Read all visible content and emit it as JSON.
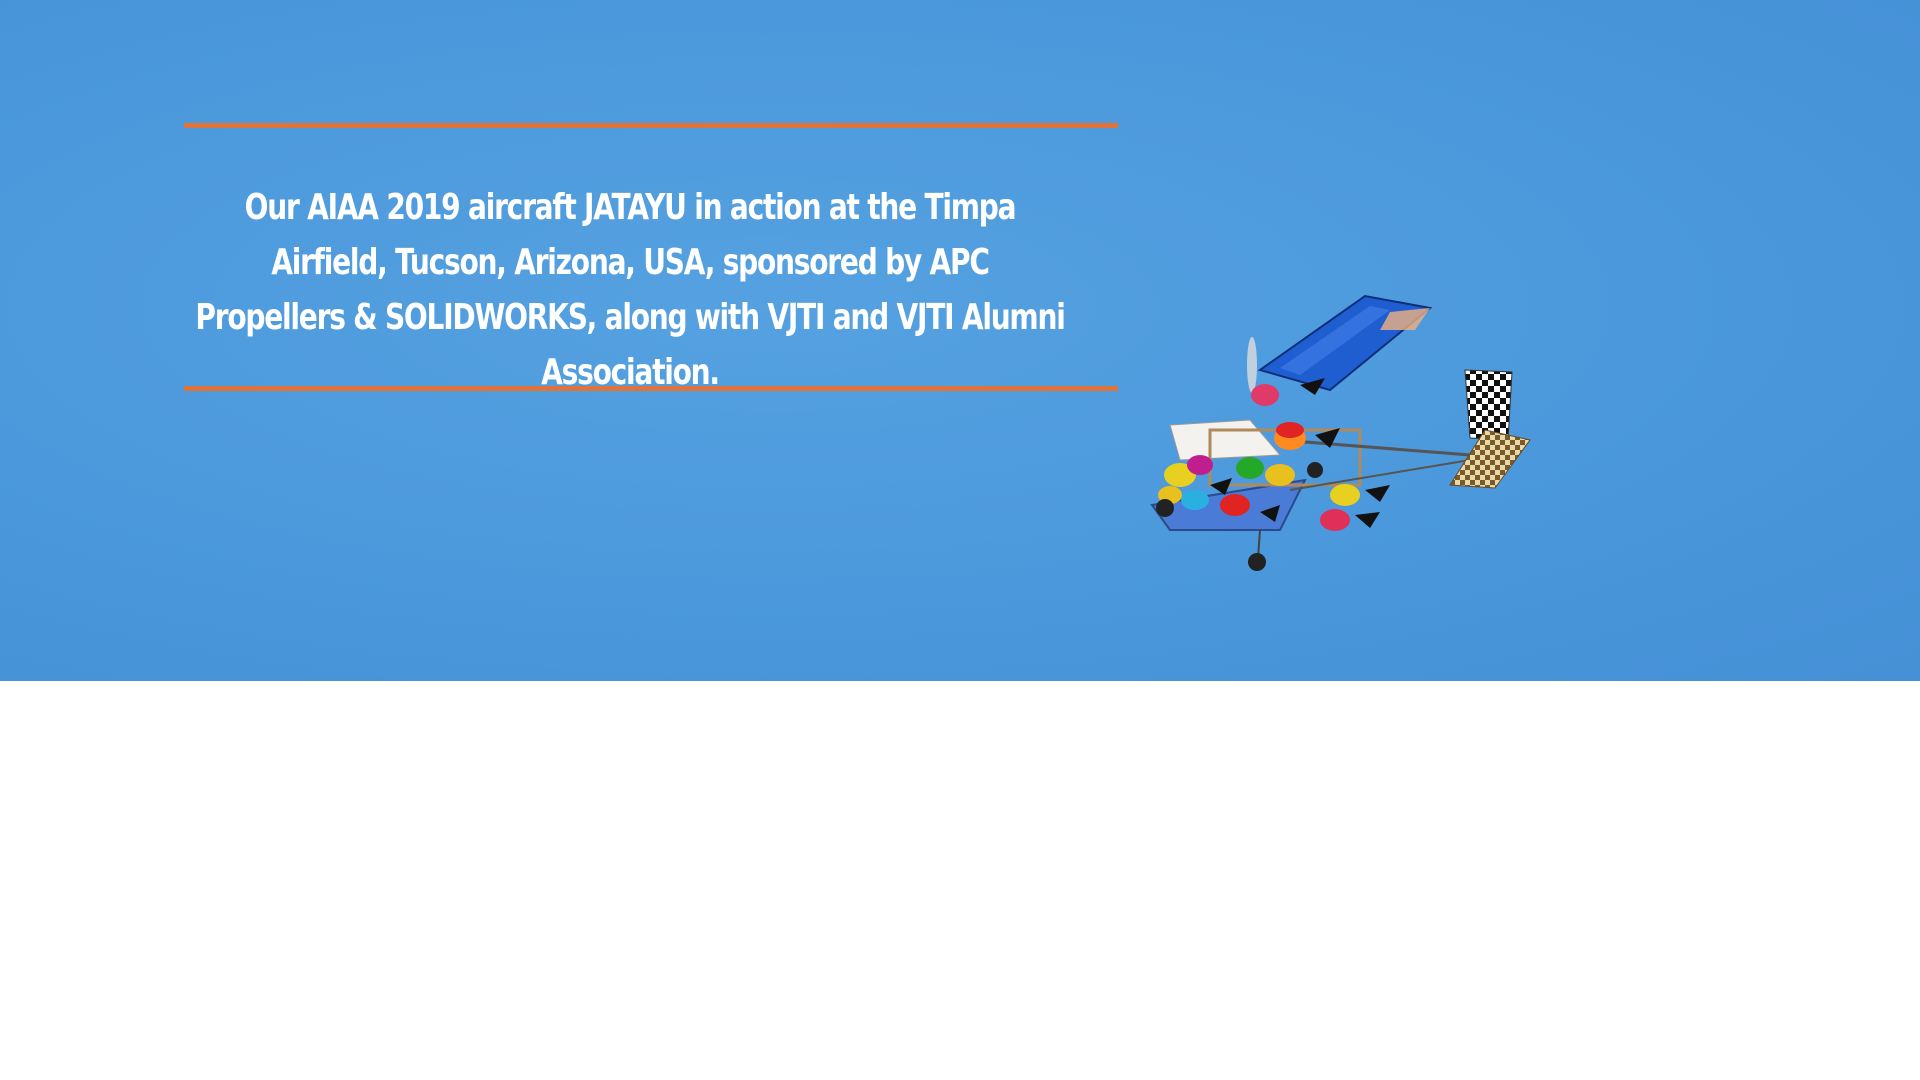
{
  "hero": {
    "caption": "Our AIAA 2019 aircraft JATAYU in action at the Timpa Airfield, Tucson, Arizona, USA, sponsored by APC Propellers & SOLIDWORKS, along with VJTI and VJTI Alumni Association.",
    "image_subject": "rc-aircraft-in-flight",
    "colors": {
      "sky": "#4b98dc",
      "divider": "#e0733a",
      "text": "#ffffff"
    }
  }
}
